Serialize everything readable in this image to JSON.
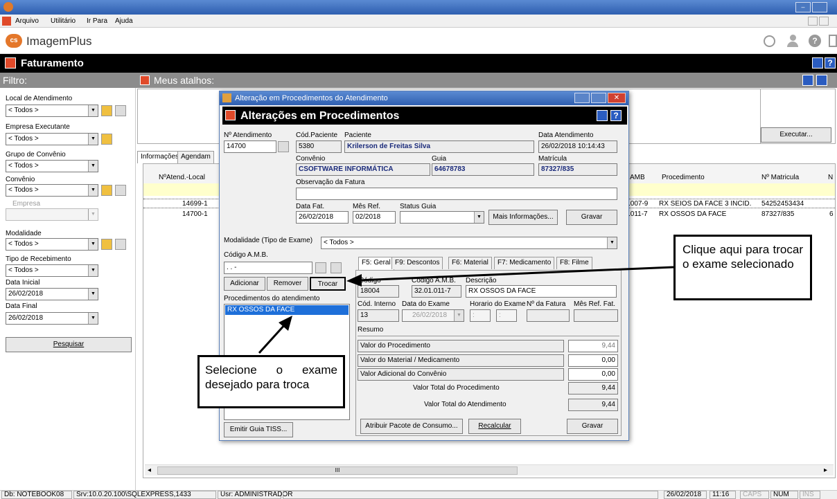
{
  "menu": {
    "items": [
      "Arquivo",
      "Utilitário",
      "Ir Para",
      "Ajuda"
    ]
  },
  "brand": {
    "name": "ImagemPlus",
    "logo_text": "cs"
  },
  "section": {
    "title": "Faturamento",
    "help_label": "?"
  },
  "filter": {
    "title": "Filtro:",
    "local_label": "Local de Atendimento",
    "local_value": "< Todos >",
    "empresa_exec_label": "Empresa Executante",
    "empresa_exec_value": "< Todos >",
    "grupo_label": "Grupo de Convênio",
    "grupo_value": "< Todos >",
    "convenio_label": "Convênio",
    "convenio_value": "< Todos >",
    "empresa_label": "Empresa",
    "modalidade_label": "Modalidade",
    "modalidade_value": "< Todos >",
    "tipo_receb_label": "Tipo de Recebimento",
    "tipo_receb_value": "< Todos >",
    "data_inicial_label": "Data Inicial",
    "data_inicial_value": "26/02/2018",
    "data_final_label": "Data Final",
    "data_final_value": "26/02/2018",
    "pesquisar_label": "Pesquisar"
  },
  "atalhos": {
    "title": "Meus atalhos:",
    "executar_label": "Executar..."
  },
  "main_tabs": [
    "Informações",
    "Agendam"
  ],
  "grid": {
    "headers": {
      "nro": "NºAtend.-Local",
      "amb": "AMB",
      "proc": "Procedimento",
      "matricula": "Nº Matricula",
      "n": "N"
    },
    "rows": [
      {
        "nro": "14699-1",
        "amb": ".007-9",
        "proc": "RX SEIOS DA FACE 3 INCID.",
        "matricula": "54252453434",
        "n": ""
      },
      {
        "nro": "14700-1",
        "amb": ".011-7",
        "proc": "RX OSSOS DA FACE",
        "matricula": "87327/835",
        "n": "6"
      }
    ],
    "scroll_glyph": "III"
  },
  "dialog": {
    "window_title": "Alteração em Procedimentos do Atendimento",
    "header": "Alterações em Procedimentos",
    "help_label": "?",
    "atend_label": "Nº Atendimento",
    "atend_value": "14700",
    "cod_pac_label": "Cód.Paciente",
    "cod_pac_value": "5380",
    "paciente_label": "Paciente",
    "paciente_value": "Krilerson de Freitas Silva",
    "data_atend_label": "Data Atendimento",
    "data_atend_value": "26/02/2018 10:14:43",
    "convenio_label": "Convênio",
    "convenio_value": "CSOFTWARE INFORMÁTICA",
    "guia_label": "Guia",
    "guia_value": "64678783",
    "matricula_label": "Matrícula",
    "matricula_value": "87327/835",
    "obs_label": "Observação da Fatura",
    "data_fat_label": "Data Fat.",
    "data_fat_value": "26/02/2018",
    "mes_ref_label": "Mês Ref.",
    "mes_ref_value": "02/2018",
    "status_guia_label": "Status Guia",
    "mais_info_label": "Mais Informações...",
    "gravar_label": "Gravar",
    "modalidade_label": "Modalidade (Tipo de Exame)",
    "modalidade_value": "< Todos >",
    "codigo_amb_label": "Código A.M.B.",
    "codigo_amb_value": ". . -",
    "adicionar_label": "Adicionar",
    "remover_label": "Remover",
    "trocar_label": "Trocar",
    "proc_list_label": "Procedimentos do atendimento",
    "proc_list": [
      "RX OSSOS DA FACE"
    ],
    "emitir_label": "Emitir Guia TISS...",
    "tabs": [
      "F5: Geral",
      "F9: Descontos",
      "F6: Material",
      "F7: Medicamento",
      "F8: Filme"
    ],
    "geral": {
      "codigo_label": "Código",
      "codigo_value": "18004",
      "amb_label": "Código A.M.B.",
      "amb_value": "32.01.011-7",
      "descricao_label": "Descrição",
      "descricao_value": "RX OSSOS DA FACE",
      "cod_interno_label": "Cód. Interno",
      "cod_interno_value": "13",
      "data_exame_label": "Data do Exame",
      "data_exame_value": "26/02/2018",
      "horario_label": "Horario do Exame",
      "horario_sep": ":",
      "fatura_label": "Nº da Fatura",
      "mes_ref_fat_label": "Mês Ref. Fat.",
      "resumo_label": "Resumo",
      "valor_proc_label": "Valor do Procedimento",
      "valor_proc_value": "9,44",
      "valor_mat_label": "Valor do Material / Medicamento",
      "valor_mat_value": "0,00",
      "valor_adic_label": "Valor Adicional do Convênio",
      "valor_adic_value": "0,00",
      "total_proc_label": "Valor Total do Procedimento",
      "total_proc_value": "9,44",
      "total_atend_label": "Valor Total do Atendimento",
      "total_atend_value": "9,44",
      "atribuir_label": "Atribuir Pacote de Consumo...",
      "recalcular_label": "Recalcular",
      "gravar_label": "Gravar"
    }
  },
  "callouts": {
    "trocar_hint": "Clique aqui para trocar o exame selecionado",
    "select_hint": "Selecione o exame desejado para troca"
  },
  "statusbar": {
    "db": "Db: NOTEBOOK08",
    "srv": "Srv:10.0.20.100\\SQLEXPRESS,1433",
    "usr": "Usr: ADMINISTRADOR",
    "date": "26/02/2018",
    "time": "11:16",
    "caps": "CAPS",
    "num": "NUM",
    "ins": "INS"
  },
  "colors": {
    "titlebar": "#2f5fb0",
    "section_bg": "#000000",
    "panel_gray": "#8c8c8c",
    "accent_orange": "#e04a2a",
    "highlight_blue": "#1e6fd9",
    "row_yellow": "#ffffcc"
  }
}
